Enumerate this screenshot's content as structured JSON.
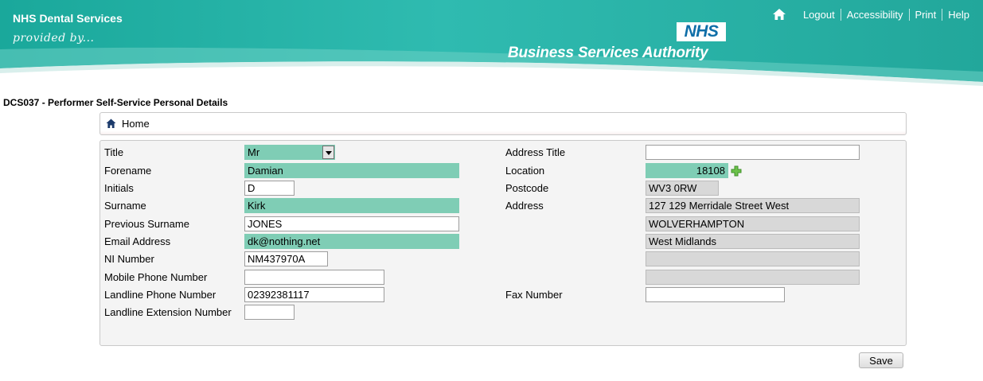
{
  "header": {
    "brand_title": "NHS Dental Services",
    "brand_subtitle": "provided by...",
    "nhs_logo_text": "NHS",
    "authority_text": "Business Services Authority",
    "nav": [
      "Logout",
      "Accessibility",
      "Print",
      "Help"
    ]
  },
  "page_title": "DCS037 - Performer Self-Service Personal Details",
  "breadcrumb": {
    "label": "Home"
  },
  "form": {
    "left": {
      "title_label": "Title",
      "title_value": "Mr",
      "forename_label": "Forename",
      "forename_value": "Damian",
      "initials_label": "Initials",
      "initials_value": "D",
      "surname_label": "Surname",
      "surname_value": "Kirk",
      "previous_surname_label": "Previous Surname",
      "previous_surname_value": "JONES",
      "email_label": "Email Address",
      "email_value": "dk@nothing.net",
      "ni_label": "NI Number",
      "ni_value": "NM437970A",
      "mobile_label": "Mobile Phone Number",
      "mobile_value": "",
      "landline_label": "Landline Phone Number",
      "landline_value": "02392381117",
      "extension_label": "Landline Extension Number",
      "extension_value": ""
    },
    "right": {
      "address_title_label": "Address Title",
      "address_title_value": "",
      "location_label": "Location",
      "location_value": "18108",
      "postcode_label": "Postcode",
      "postcode_value": "WV3 0RW",
      "address_label": "Address",
      "address_lines": [
        "127 129 Merridale Street West",
        "WOLVERHAMPTON",
        "West Midlands",
        "",
        ""
      ],
      "fax_label": "Fax Number",
      "fax_value": ""
    }
  },
  "save_label": "Save",
  "colors": {
    "teal": "#2bb3a6",
    "required_field": "#7fcdb5",
    "readonly_field": "#d8d8d8",
    "nhs_blue": "#0f6ea8"
  },
  "icons": {
    "home": "home-icon",
    "add_location": "plus-icon"
  }
}
